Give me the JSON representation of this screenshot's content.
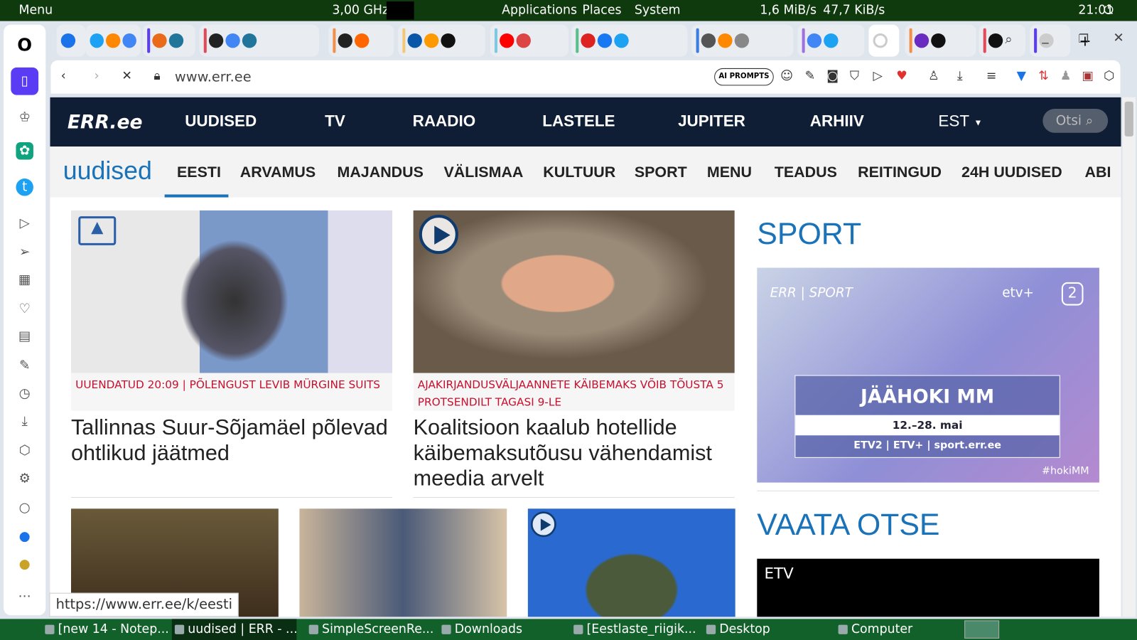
{
  "system_bar": {
    "menu": "Menu",
    "cpu": "3,00 GHz",
    "applications": "Applications",
    "places": "Places",
    "system": "System",
    "network": "1,6 MiB/s",
    "upload": "47,7 KiB/s",
    "clock": "21:01"
  },
  "browser": {
    "url": "www.err.ee",
    "ai_prompts": "AI PROMPTS",
    "status_url": "https://www.err.ee/k/eesti"
  },
  "site": {
    "logo": "ERR.ee",
    "main_nav": [
      "UUDISED",
      "TV",
      "RAADIO",
      "LASTELE",
      "JUPITER",
      "ARHIIV",
      "EST"
    ],
    "search_placeholder": "Otsi",
    "section": "uudised",
    "sub_nav": [
      "EESTI",
      "ARVAMUS",
      "MAJANDUS",
      "VÄLISMAA",
      "KULTUUR",
      "SPORT",
      "MENU",
      "TEADUS",
      "REITINGUD",
      "24H UUDISED",
      "ABI"
    ],
    "articles": [
      {
        "kicker": "Uuendatud 20:09 | Põlengust levib mürgine suits",
        "headline": "Tallinnas Suur-Sõjamäel põlevad ohtlikud jäätmed"
      },
      {
        "kicker": "Ajakirjandusväljaannete käibemaks võib tõusta 5 protsendilt tagasi 9-le",
        "headline": "Koalitsioon kaalub hotellide käibemaksutõusu vähendamist meedia arvelt"
      }
    ],
    "sport": {
      "title": "SPORT",
      "banner_brand": "ERR | SPORT",
      "banner_channel": "etv+",
      "banner_title": "JÄÄHOKI MM",
      "banner_dates": "12.–28. mai",
      "banner_channels": "ETV2 | ETV+ | sport.err.ee",
      "banner_tag": "#hokiMM"
    },
    "live": {
      "title": "VAATA OTSE",
      "channel": "ETV"
    }
  },
  "taskbar": [
    "[new 14 - Notep...",
    "uudised | ERR - ...",
    "SimpleScreenRe...",
    "Downloads",
    "[Eestlaste_riigik...",
    "Desktop",
    "Computer"
  ]
}
